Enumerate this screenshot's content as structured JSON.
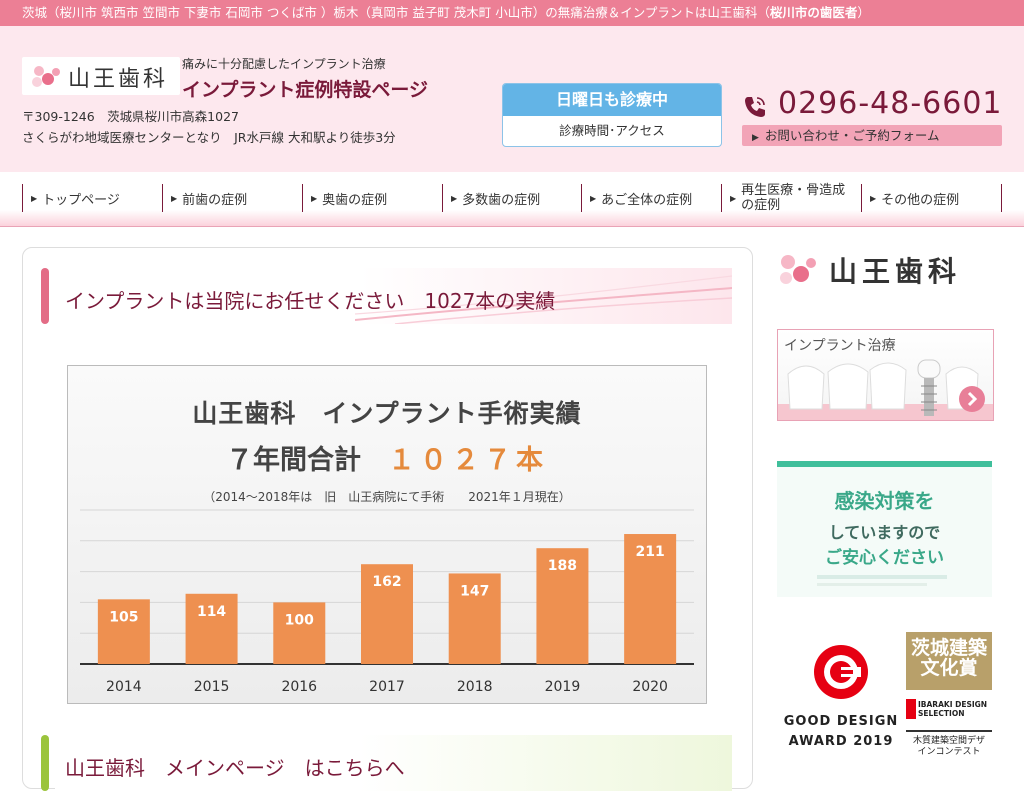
{
  "topbar": {
    "text": "茨城（桜川市 筑西市 笠間市 下妻市 石岡市 つくば市 ）栃木（真岡市 益子町 茂木町 小山市）の無痛治療＆インプラントは山王歯科（",
    "bold": "桜川市の歯医者",
    "close": "）"
  },
  "header": {
    "logo_text": "山王歯科",
    "tagline": "痛みに十分配慮したインプラント治療",
    "page_title": "インプラント症例特設ページ",
    "address": "〒309-1246　茨城県桜川市高森1027",
    "access": "さくらがわ地域医療センターとなり　JR水戸線 大和駅より徒歩3分",
    "sunday_label": "日曜日も診療中",
    "hours_label": "診療時間･アクセス",
    "phone": "0296-48-6601",
    "contact_label": "お問い合わせ・ご予約フォーム"
  },
  "nav": {
    "items": [
      {
        "label": "トップページ"
      },
      {
        "label": "前歯の症例"
      },
      {
        "label": "奥歯の症例"
      },
      {
        "label": "多数歯の症例"
      },
      {
        "label": "あご全体の症例"
      },
      {
        "label": "再生医療・骨造成の症例"
      },
      {
        "label": "その他の症例"
      }
    ]
  },
  "main": {
    "heading": "インプラントは当院にお任せください　1027本の実績",
    "heading2": "山王歯科　メインページ　はこちらへ"
  },
  "chart_data": {
    "type": "bar",
    "title": "山王歯科　インプラント手術実績",
    "subtitle_prefix": "７年間合計",
    "subtitle_value": "１０２７本",
    "note": "（2014〜2018年は　旧　山王病院にて手術　　2021年１月現在）",
    "categories": [
      "2014",
      "2015",
      "2016",
      "2017",
      "2018",
      "2019",
      "2020"
    ],
    "values": [
      105,
      114,
      100,
      162,
      147,
      188,
      211
    ],
    "ylim": [
      0,
      250
    ],
    "grid": true,
    "bar_color": "#ee9050"
  },
  "sidebar": {
    "logo_text": "山王歯科",
    "implant_banner": "インプラント治療",
    "covid_line1": "感染対策を",
    "covid_line2": "していますので",
    "covid_line3": "ご安心ください",
    "gd_line1": "GOOD DESIGN",
    "gd_line2": "AWARD 2019",
    "ibaraki_award": "茨城建築文化賞",
    "ibaraki_selection": "IBARAKI DESIGN SELECTION",
    "wood_contest": "木質建築空間デザインコンテスト"
  }
}
